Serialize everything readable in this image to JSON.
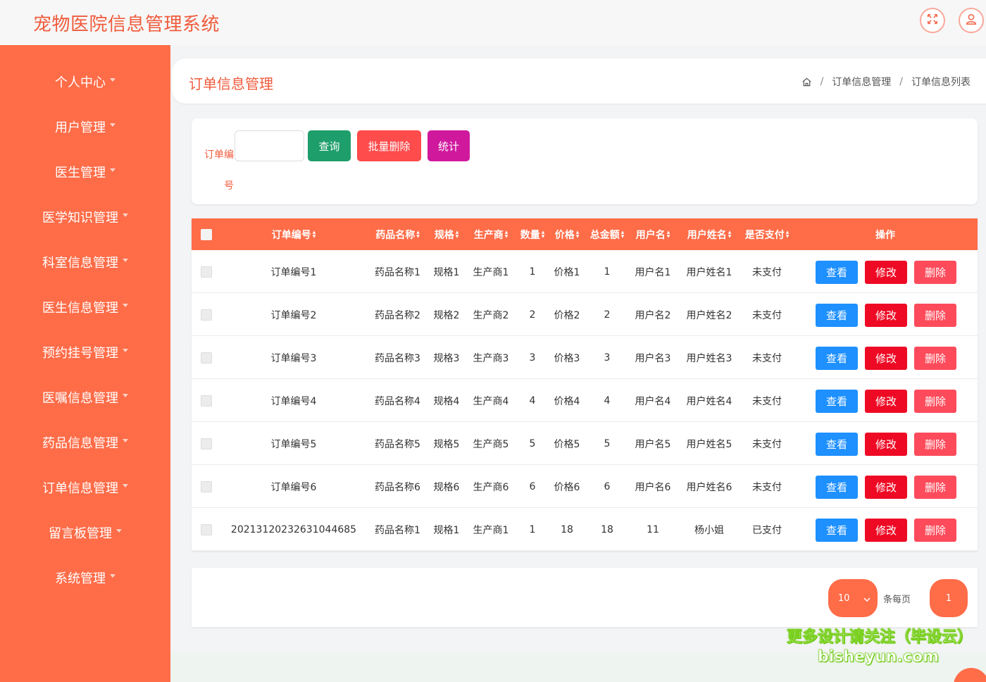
{
  "header": {
    "title": "宠物医院信息管理系统",
    "icons": [
      "fullscreen-icon",
      "user-icon"
    ]
  },
  "sidebar": {
    "items": [
      {
        "label": "个人中心"
      },
      {
        "label": "用户管理"
      },
      {
        "label": "医生管理"
      },
      {
        "label": "医学知识管理"
      },
      {
        "label": "科室信息管理"
      },
      {
        "label": "医生信息管理"
      },
      {
        "label": "预约挂号管理"
      },
      {
        "label": "医嘱信息管理"
      },
      {
        "label": "药品信息管理"
      },
      {
        "label": "订单信息管理"
      },
      {
        "label": "留言板管理"
      },
      {
        "label": "系统管理"
      }
    ]
  },
  "page": {
    "title": "订单信息管理",
    "breadcrumb": [
      "订单信息管理",
      "订单信息列表"
    ],
    "breadcrumb_sep": "/"
  },
  "search": {
    "label": "订单编号",
    "value": "",
    "query_label": "查询",
    "batch_delete_label": "批量删除",
    "stats_label": "统计"
  },
  "colors": {
    "accent": "#fe6c48",
    "query": "#1e9e6a",
    "batch_delete": "#fe4b4b",
    "stats": "#d0189d",
    "view": "#1e90ff",
    "edit": "#ee0a24",
    "delete": "#fd4b5b"
  },
  "table": {
    "headers": [
      "订单编号",
      "药品名称",
      "规格",
      "生产商",
      "数量",
      "价格",
      "总金额",
      "用户名",
      "用户姓名",
      "是否支付",
      "操作"
    ],
    "action_labels": {
      "view": "查看",
      "edit": "修改",
      "delete": "删除"
    },
    "rows": [
      [
        "订单编号1",
        "药品名称1",
        "规格1",
        "生产商1",
        "1",
        "价格1",
        "1",
        "用户名1",
        "用户姓名1",
        "未支付"
      ],
      [
        "订单编号2",
        "药品名称2",
        "规格2",
        "生产商2",
        "2",
        "价格2",
        "2",
        "用户名2",
        "用户姓名2",
        "未支付"
      ],
      [
        "订单编号3",
        "药品名称3",
        "规格3",
        "生产商3",
        "3",
        "价格3",
        "3",
        "用户名3",
        "用户姓名3",
        "未支付"
      ],
      [
        "订单编号4",
        "药品名称4",
        "规格4",
        "生产商4",
        "4",
        "价格4",
        "4",
        "用户名4",
        "用户姓名4",
        "未支付"
      ],
      [
        "订单编号5",
        "药品名称5",
        "规格5",
        "生产商5",
        "5",
        "价格5",
        "5",
        "用户名5",
        "用户姓名5",
        "未支付"
      ],
      [
        "订单编号6",
        "药品名称6",
        "规格6",
        "生产商6",
        "6",
        "价格6",
        "6",
        "用户名6",
        "用户姓名6",
        "未支付"
      ],
      [
        "20213120232631044685",
        "药品名称1",
        "规格1",
        "生产商1",
        "1",
        "18",
        "18",
        "11",
        "杨小姐",
        "已支付"
      ]
    ]
  },
  "pagination": {
    "page_size": "10",
    "per_page_text": "条每页",
    "current_page": "1"
  },
  "watermark": {
    "line1": "更多设计请关注（毕设云）",
    "line2": "bisheyun.com"
  }
}
